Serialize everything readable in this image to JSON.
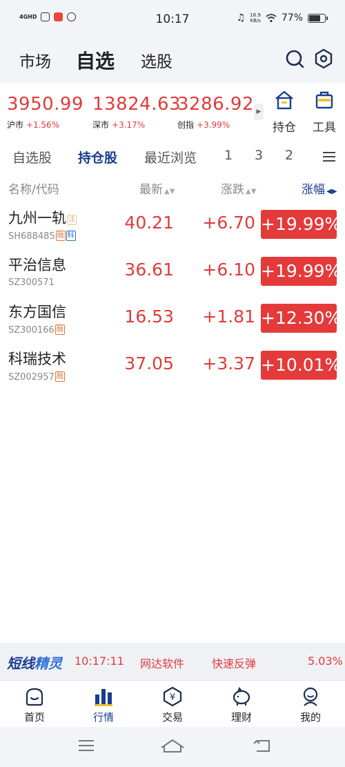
{
  "status_bar": {
    "network": "4GHD",
    "time": "10:17",
    "speed_value": "16.9",
    "speed_unit": "KB/s",
    "battery": "77%",
    "battery_level": 0.77
  },
  "top_nav": {
    "tabs": [
      "市场",
      "自选",
      "选股"
    ],
    "active_tab": "自选",
    "icons": [
      "search-icon",
      "settings-icon"
    ]
  },
  "indices": [
    {
      "value": "3950.99",
      "name": "沪市",
      "change": "+1.56%"
    },
    {
      "value": "13824.63",
      "name": "深市",
      "change": "+3.17%"
    },
    {
      "value": "3286.92",
      "name": "创指",
      "change": "+3.99%"
    }
  ],
  "tools": [
    {
      "label": "持仓",
      "icon": "house-icon"
    },
    {
      "label": "工具",
      "icon": "toolbox-icon"
    }
  ],
  "sub_tabs": [
    "自选股",
    "持仓股",
    "最近浏览",
    "1",
    "3",
    "2"
  ],
  "active_sub_tab": "持仓股",
  "columns": {
    "name": "名称/代码",
    "latest": "最新",
    "change": "涨跌",
    "pct": "涨幅",
    "sort_arrows": "▲▼",
    "active_sort": "◀▶"
  },
  "stocks": [
    {
      "name": "九州一轨",
      "code": "SH688485",
      "tags": [
        "注",
        "融",
        "科"
      ],
      "latest": "40.21",
      "change": "+6.70",
      "pct": "+19.99%"
    },
    {
      "name": "平治信息",
      "code": "SZ300571",
      "tags": [],
      "latest": "36.61",
      "change": "+6.10",
      "pct": "+19.99%"
    },
    {
      "name": "东方国信",
      "code": "SZ300166",
      "tags": [
        "融"
      ],
      "latest": "16.53",
      "change": "+1.81",
      "pct": "+12.30%"
    },
    {
      "name": "科瑞技术",
      "code": "SZ002957",
      "tags": [
        "融"
      ],
      "latest": "37.05",
      "change": "+3.37",
      "pct": "+10.01%"
    }
  ],
  "banner": {
    "logo_part1": "短线",
    "logo_part2": "精灵",
    "time": "10:17:11",
    "stock": "网达软件",
    "signal": "快速反弹",
    "value": "5.03%"
  },
  "bottom_nav": [
    {
      "label": "首页",
      "icon": "home-icon"
    },
    {
      "label": "行情",
      "icon": "chart-icon"
    },
    {
      "label": "交易",
      "icon": "yuan-icon"
    },
    {
      "label": "理财",
      "icon": "piggy-bank-icon"
    },
    {
      "label": "我的",
      "icon": "profile-icon"
    }
  ],
  "active_bottom_tab": "行情",
  "colors": {
    "up_red": "#e03b3b",
    "badge_red": "#e43a3a",
    "active_blue": "#1a3d8c"
  }
}
